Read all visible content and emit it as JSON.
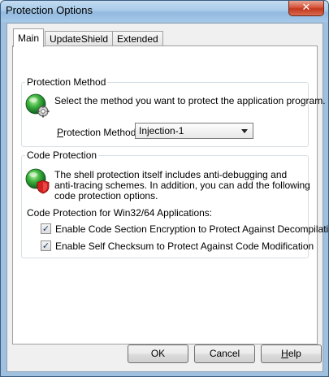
{
  "window": {
    "title": "Protection Options",
    "close_glyph": "✕"
  },
  "tabs": [
    {
      "label": "Main",
      "active": true
    },
    {
      "label": "UpdateShield",
      "active": false
    },
    {
      "label": "Extended",
      "active": false
    }
  ],
  "protection_method": {
    "group_title": "Protection Method",
    "icon": "globe-gear-icon",
    "description": "Select the method you want to protect the application program.",
    "label_prefix": "P",
    "label_rest": "rotection Method:",
    "selected": "Injection-1"
  },
  "code_protection": {
    "group_title": "Code Protection",
    "icon": "globe-shield-icon",
    "description_line1": "The shell protection itself includes anti-debugging and",
    "description_line2": "anti-tracing schemes. In addition, you can add the following",
    "description_line3": "code protection options.",
    "subheading": "Code Protection for Win32/64 Applications:",
    "options": [
      {
        "label": "Enable Code Section Encryption to Protect Against Decompilation",
        "checked": true,
        "mark": "✓"
      },
      {
        "label": "Enable Self Checksum to Protect Against Code Modification",
        "checked": true,
        "mark": "✓"
      }
    ]
  },
  "buttons": {
    "ok": "OK",
    "cancel": "Cancel",
    "help_prefix": "H",
    "help_rest": "elp"
  },
  "colors": {
    "titlebar": "#a9cbea",
    "close": "#c3381e",
    "globe_green": "#2f9e2f",
    "shield_red": "#d21f1f"
  }
}
